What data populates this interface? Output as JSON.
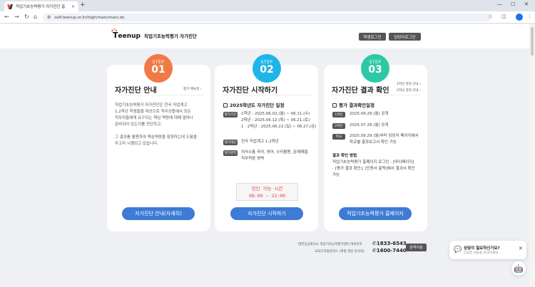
{
  "browser": {
    "tab_title": "직업기초능력평가 자가진단 홈",
    "tab_close": "×",
    "new_tab": "+",
    "min": "—",
    "max": "☐",
    "close": "✕",
    "url": "self.teenup.or.kr/high/main/main.do"
  },
  "header": {
    "logo_text": "eenup",
    "site_name": "직업기초능력평가 자가진단",
    "student_login": "학생로그인",
    "teacher_login": "담당자로그인"
  },
  "cards": [
    {
      "step": "STEP",
      "num": "01",
      "color": "#f07a45",
      "title": "자가진단 안내",
      "link": "평가 메뉴얼 ›",
      "body": [
        "직업기초능력평가 자가진단은 전국 직업계고",
        "1,2학년 학생들을 대상으로 직무상황에서 모든",
        "직무자들에게 요구되는 핵심 역량에 대해 얼마나",
        "준비되어 있는지를 진단하고,",
        "",
        "그 결과를 활용하여 핵심역량을 함양하는데 도움을",
        "주고자 시행되고 있습니다."
      ],
      "cta": "자가진단 안내(자세히)"
    },
    {
      "step": "STEP",
      "num": "02",
      "color": "#1fb5e8",
      "title": "자가진단 시작하기",
      "schedule_title": "2025학년도 자가진단 일정",
      "rows": [
        {
          "tag": "평가기간",
          "lines": [
            "1학년 : 2025.06.02.(월) ~ 06.11.(수)",
            "2학년 : 2025.06.12.(목) ~ 06.21.(토)",
            "1 · 2학년 : 2025.06.22.(일) ~ 06.27.(금)"
          ]
        },
        {
          "tag": "평가대상",
          "lines": [
            "전국 직업계고 1,2학년"
          ]
        },
        {
          "tag": "평가영역",
          "lines": [
            "의사소통 국어, 영어, 수리활용, 문제해결,",
            "직무적응 영역"
          ]
        }
      ],
      "avail_label": "진단 가능 시간",
      "avail_time": "08:00 ~ 23:00",
      "cta": "자가진단 시작하기"
    },
    {
      "step": "STEP",
      "num": "03",
      "color": "#2dc9a6",
      "title": "자가진단 결과 확인",
      "link1": "1학년 결과 안내 ›",
      "link2": "2학년 결과 안내 ›",
      "schedule_title": "평가 결과확인일정",
      "rows": [
        {
          "tag": "1학년",
          "lines": [
            "2025.09.29.(월) 공개"
          ]
        },
        {
          "tag": "2학년",
          "lines": [
            "2025.07.28.(월) 공개"
          ]
        },
        {
          "tag": "학교",
          "lines": [
            "2025.09.29.(월)부터 담당자 페이지에서",
            "학교별 결과보고서 확인 가능"
          ]
        }
      ],
      "method_title": "결과 확인 방법",
      "method": [
        "직업기초능력평가 홈페이지 로그인 - [마이페이지]",
        "- [평가 결과 확인], [인증서 출력]에서 결과서 확인",
        "가능"
      ],
      "cta": "직업기초능력평가 홈페이지"
    }
  ],
  "footer": {
    "org1": "대한상공회의소 직업기초능력평가센터 대표번호",
    "phone1": "1833-6543",
    "org2": "교육디지털원격스 (계정 관련 문의처)",
    "phone2": "1600-7440",
    "remote": "원격지원"
  },
  "chat": {
    "title": "상담이 필요하신가요?",
    "sub": "궁금한 내용을 문의하세요.",
    "close": "✕"
  }
}
